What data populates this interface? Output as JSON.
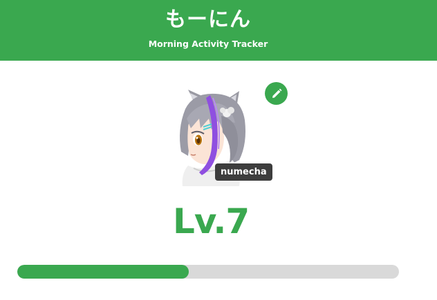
{
  "header": {
    "title": "もーにん",
    "subtitle": "Morning Activity Tracker"
  },
  "profile": {
    "username": "numecha",
    "level_label": "Lv.7",
    "edit_icon": "pencil-icon",
    "avatar_icon": "anime-character-avatar"
  },
  "progress": {
    "value_percent": 45
  },
  "colors": {
    "accent": "#3aa84f",
    "track": "#d9d9d9",
    "name_tag_bg": "#3d3d3d"
  }
}
